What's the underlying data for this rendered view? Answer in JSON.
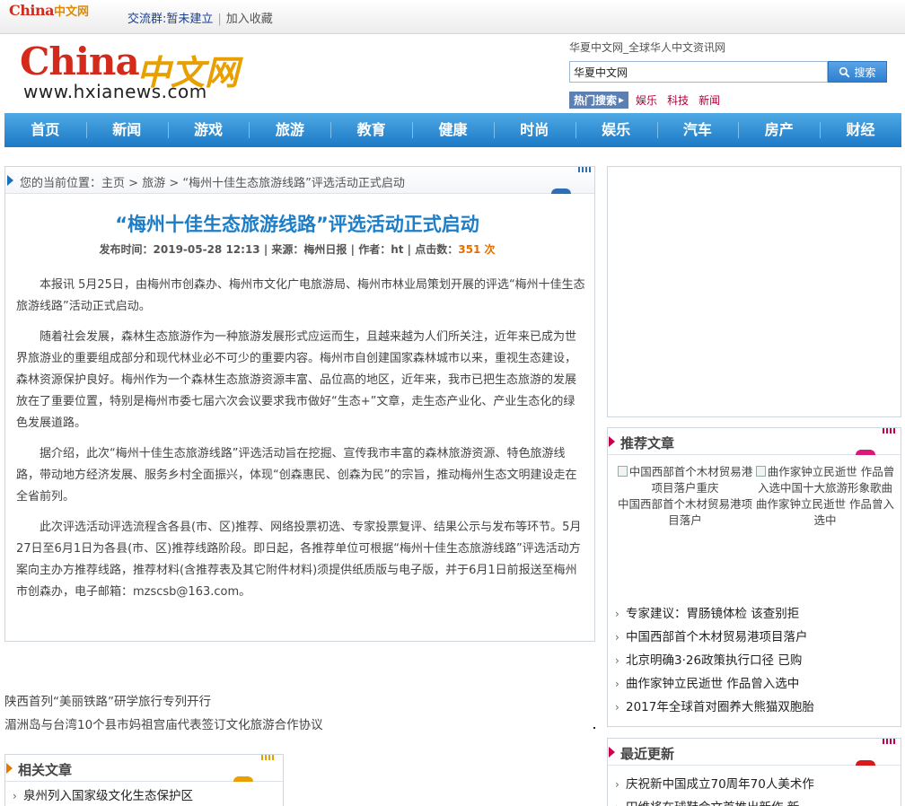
{
  "topbar": {
    "mini_logo_en": "China",
    "mini_logo_cn": "中文网",
    "group_label": "交流群:",
    "group_value": "暂未建立",
    "favorite": "加入收藏"
  },
  "header": {
    "logo_en": "China",
    "logo_cn": "中文网",
    "logo_url": "www.hxianews.com",
    "slogan": "华夏中文网_全球华人中文资讯网",
    "search_value": "华夏中文网",
    "search_button": "搜索",
    "hot_label": "热门搜索",
    "hot_items": [
      "娱乐",
      "科技",
      "新闻"
    ]
  },
  "nav": [
    "首页",
    "新闻",
    "游戏",
    "旅游",
    "教育",
    "健康",
    "时尚",
    "娱乐",
    "汽车",
    "房产",
    "财经"
  ],
  "breadcrumb": {
    "prefix": "您的当前位置：",
    "home": "主页",
    "sep": " > ",
    "section": "旅游",
    "current": "“梅州十佳生态旅游线路”评选活动正式启动"
  },
  "article": {
    "title": "“梅州十佳生态旅游线路”评选活动正式启动",
    "meta_time_label": "发布时间：",
    "meta_time": "2019-05-28 12:13",
    "meta_source_label": "来源：",
    "meta_source": "梅州日报",
    "meta_author_label": "作者：",
    "meta_author": "ht",
    "meta_hits_label": "点击数：",
    "meta_hits": "351 次",
    "paragraphs": [
      "本报讯 5月25日，由梅州市创森办、梅州市文化广电旅游局、梅州市林业局策划开展的评选“梅州十佳生态旅游线路”活动正式启动。",
      "随着社会发展，森林生态旅游作为一种旅游发展形式应运而生，且越来越为人们所关注，近年来已成为世界旅游业的重要组成部分和现代林业必不可少的重要内容。梅州市自创建国家森林城市以来，重视生态建设，森林资源保护良好。梅州作为一个森林生态旅游资源丰富、品位高的地区，近年来，我市已把生态旅游的发展放在了重要位置，特别是梅州市委七届六次会议要求我市做好“生态+”文章，走生态产业化、产业生态化的绿色发展道路。",
      "据介绍，此次“梅州十佳生态旅游线路”评选活动旨在挖掘、宣传我市丰富的森林旅游资源、特色旅游线路，带动地方经济发展、服务乡村全面振兴，体现“创森惠民、创森为民”的宗旨，推动梅州生态文明建设走在全省前列。",
      "此次评选活动评选流程含各县(市、区)推荐、网络投票初选、专家投票复评、结果公示与发布等环节。5月27日至6月1日为各县(市、区)推荐线路阶段。即日起，各推荐单位可根据“梅州十佳生态旅游线路”评选活动方案向主办方推荐线路，推荐材料(含推荐表及其它附件材料)须提供纸质版与电子版，并于6月1日前报送至梅州市创森办，电子邮箱：mzscsb@163.com。"
    ]
  },
  "recommended": {
    "title": "推荐文章",
    "pics": [
      {
        "alt": "中国西部首个木材贸易港项目落户重庆",
        "caption": "中国西部首个木材贸易港项目落户"
      },
      {
        "alt": "曲作家钟立民逝世 作品曾入选中国十大旅游形象歌曲",
        "caption": "曲作家钟立民逝世 作品曾入选中"
      }
    ],
    "list": [
      "专家建议：胃肠镜体检 该查别拒",
      "中国西部首个木材贸易港项目落户",
      "北京明确3·26政策执行口径 已购",
      "曲作家钟立民逝世 作品曾入选中",
      "2017年全球首对圈养大熊猫双胞胎"
    ]
  },
  "latest": {
    "title": "最近更新",
    "list": [
      "庆祝新中国成立70周年70人美术作",
      "田维将在球鞋会文首推出新作 新"
    ]
  },
  "free_links": [
    "陕西首列“美丽铁路”研学旅行专列开行",
    "湄洲岛与台湾10个县市妈祖宫庙代表签订文化旅游合作协议"
  ],
  "related": {
    "title": "相关文章",
    "list": [
      "泉州列入国家级文化生态保护区"
    ]
  },
  "colors": {
    "nav_blue": "#1c79c6",
    "title_blue": "#1d7ec8",
    "hits_orange": "#e46e00",
    "brand_red": "#d42a1c",
    "accent_magenta": "#c8004b"
  }
}
